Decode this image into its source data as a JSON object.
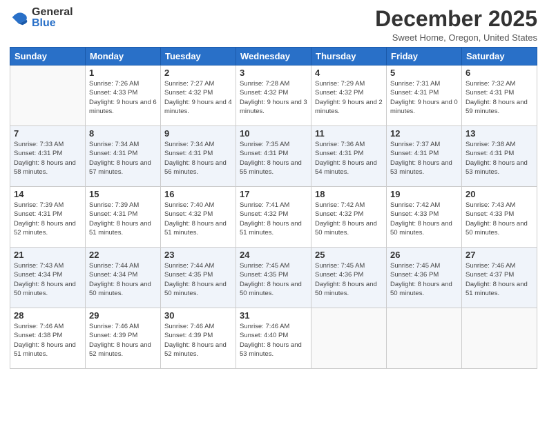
{
  "header": {
    "logo_general": "General",
    "logo_blue": "Blue",
    "month_title": "December 2025",
    "location": "Sweet Home, Oregon, United States"
  },
  "weekdays": [
    "Sunday",
    "Monday",
    "Tuesday",
    "Wednesday",
    "Thursday",
    "Friday",
    "Saturday"
  ],
  "weeks": [
    [
      {
        "day": "",
        "sunrise": "",
        "sunset": "",
        "daylight": ""
      },
      {
        "day": "1",
        "sunrise": "Sunrise: 7:26 AM",
        "sunset": "Sunset: 4:33 PM",
        "daylight": "Daylight: 9 hours and 6 minutes."
      },
      {
        "day": "2",
        "sunrise": "Sunrise: 7:27 AM",
        "sunset": "Sunset: 4:32 PM",
        "daylight": "Daylight: 9 hours and 4 minutes."
      },
      {
        "day": "3",
        "sunrise": "Sunrise: 7:28 AM",
        "sunset": "Sunset: 4:32 PM",
        "daylight": "Daylight: 9 hours and 3 minutes."
      },
      {
        "day": "4",
        "sunrise": "Sunrise: 7:29 AM",
        "sunset": "Sunset: 4:32 PM",
        "daylight": "Daylight: 9 hours and 2 minutes."
      },
      {
        "day": "5",
        "sunrise": "Sunrise: 7:31 AM",
        "sunset": "Sunset: 4:31 PM",
        "daylight": "Daylight: 9 hours and 0 minutes."
      },
      {
        "day": "6",
        "sunrise": "Sunrise: 7:32 AM",
        "sunset": "Sunset: 4:31 PM",
        "daylight": "Daylight: 8 hours and 59 minutes."
      }
    ],
    [
      {
        "day": "7",
        "sunrise": "Sunrise: 7:33 AM",
        "sunset": "Sunset: 4:31 PM",
        "daylight": "Daylight: 8 hours and 58 minutes."
      },
      {
        "day": "8",
        "sunrise": "Sunrise: 7:34 AM",
        "sunset": "Sunset: 4:31 PM",
        "daylight": "Daylight: 8 hours and 57 minutes."
      },
      {
        "day": "9",
        "sunrise": "Sunrise: 7:34 AM",
        "sunset": "Sunset: 4:31 PM",
        "daylight": "Daylight: 8 hours and 56 minutes."
      },
      {
        "day": "10",
        "sunrise": "Sunrise: 7:35 AM",
        "sunset": "Sunset: 4:31 PM",
        "daylight": "Daylight: 8 hours and 55 minutes."
      },
      {
        "day": "11",
        "sunrise": "Sunrise: 7:36 AM",
        "sunset": "Sunset: 4:31 PM",
        "daylight": "Daylight: 8 hours and 54 minutes."
      },
      {
        "day": "12",
        "sunrise": "Sunrise: 7:37 AM",
        "sunset": "Sunset: 4:31 PM",
        "daylight": "Daylight: 8 hours and 53 minutes."
      },
      {
        "day": "13",
        "sunrise": "Sunrise: 7:38 AM",
        "sunset": "Sunset: 4:31 PM",
        "daylight": "Daylight: 8 hours and 53 minutes."
      }
    ],
    [
      {
        "day": "14",
        "sunrise": "Sunrise: 7:39 AM",
        "sunset": "Sunset: 4:31 PM",
        "daylight": "Daylight: 8 hours and 52 minutes."
      },
      {
        "day": "15",
        "sunrise": "Sunrise: 7:39 AM",
        "sunset": "Sunset: 4:31 PM",
        "daylight": "Daylight: 8 hours and 51 minutes."
      },
      {
        "day": "16",
        "sunrise": "Sunrise: 7:40 AM",
        "sunset": "Sunset: 4:32 PM",
        "daylight": "Daylight: 8 hours and 51 minutes."
      },
      {
        "day": "17",
        "sunrise": "Sunrise: 7:41 AM",
        "sunset": "Sunset: 4:32 PM",
        "daylight": "Daylight: 8 hours and 51 minutes."
      },
      {
        "day": "18",
        "sunrise": "Sunrise: 7:42 AM",
        "sunset": "Sunset: 4:32 PM",
        "daylight": "Daylight: 8 hours and 50 minutes."
      },
      {
        "day": "19",
        "sunrise": "Sunrise: 7:42 AM",
        "sunset": "Sunset: 4:33 PM",
        "daylight": "Daylight: 8 hours and 50 minutes."
      },
      {
        "day": "20",
        "sunrise": "Sunrise: 7:43 AM",
        "sunset": "Sunset: 4:33 PM",
        "daylight": "Daylight: 8 hours and 50 minutes."
      }
    ],
    [
      {
        "day": "21",
        "sunrise": "Sunrise: 7:43 AM",
        "sunset": "Sunset: 4:34 PM",
        "daylight": "Daylight: 8 hours and 50 minutes."
      },
      {
        "day": "22",
        "sunrise": "Sunrise: 7:44 AM",
        "sunset": "Sunset: 4:34 PM",
        "daylight": "Daylight: 8 hours and 50 minutes."
      },
      {
        "day": "23",
        "sunrise": "Sunrise: 7:44 AM",
        "sunset": "Sunset: 4:35 PM",
        "daylight": "Daylight: 8 hours and 50 minutes."
      },
      {
        "day": "24",
        "sunrise": "Sunrise: 7:45 AM",
        "sunset": "Sunset: 4:35 PM",
        "daylight": "Daylight: 8 hours and 50 minutes."
      },
      {
        "day": "25",
        "sunrise": "Sunrise: 7:45 AM",
        "sunset": "Sunset: 4:36 PM",
        "daylight": "Daylight: 8 hours and 50 minutes."
      },
      {
        "day": "26",
        "sunrise": "Sunrise: 7:45 AM",
        "sunset": "Sunset: 4:36 PM",
        "daylight": "Daylight: 8 hours and 50 minutes."
      },
      {
        "day": "27",
        "sunrise": "Sunrise: 7:46 AM",
        "sunset": "Sunset: 4:37 PM",
        "daylight": "Daylight: 8 hours and 51 minutes."
      }
    ],
    [
      {
        "day": "28",
        "sunrise": "Sunrise: 7:46 AM",
        "sunset": "Sunset: 4:38 PM",
        "daylight": "Daylight: 8 hours and 51 minutes."
      },
      {
        "day": "29",
        "sunrise": "Sunrise: 7:46 AM",
        "sunset": "Sunset: 4:39 PM",
        "daylight": "Daylight: 8 hours and 52 minutes."
      },
      {
        "day": "30",
        "sunrise": "Sunrise: 7:46 AM",
        "sunset": "Sunset: 4:39 PM",
        "daylight": "Daylight: 8 hours and 52 minutes."
      },
      {
        "day": "31",
        "sunrise": "Sunrise: 7:46 AM",
        "sunset": "Sunset: 4:40 PM",
        "daylight": "Daylight: 8 hours and 53 minutes."
      },
      {
        "day": "",
        "sunrise": "",
        "sunset": "",
        "daylight": ""
      },
      {
        "day": "",
        "sunrise": "",
        "sunset": "",
        "daylight": ""
      },
      {
        "day": "",
        "sunrise": "",
        "sunset": "",
        "daylight": ""
      }
    ]
  ]
}
